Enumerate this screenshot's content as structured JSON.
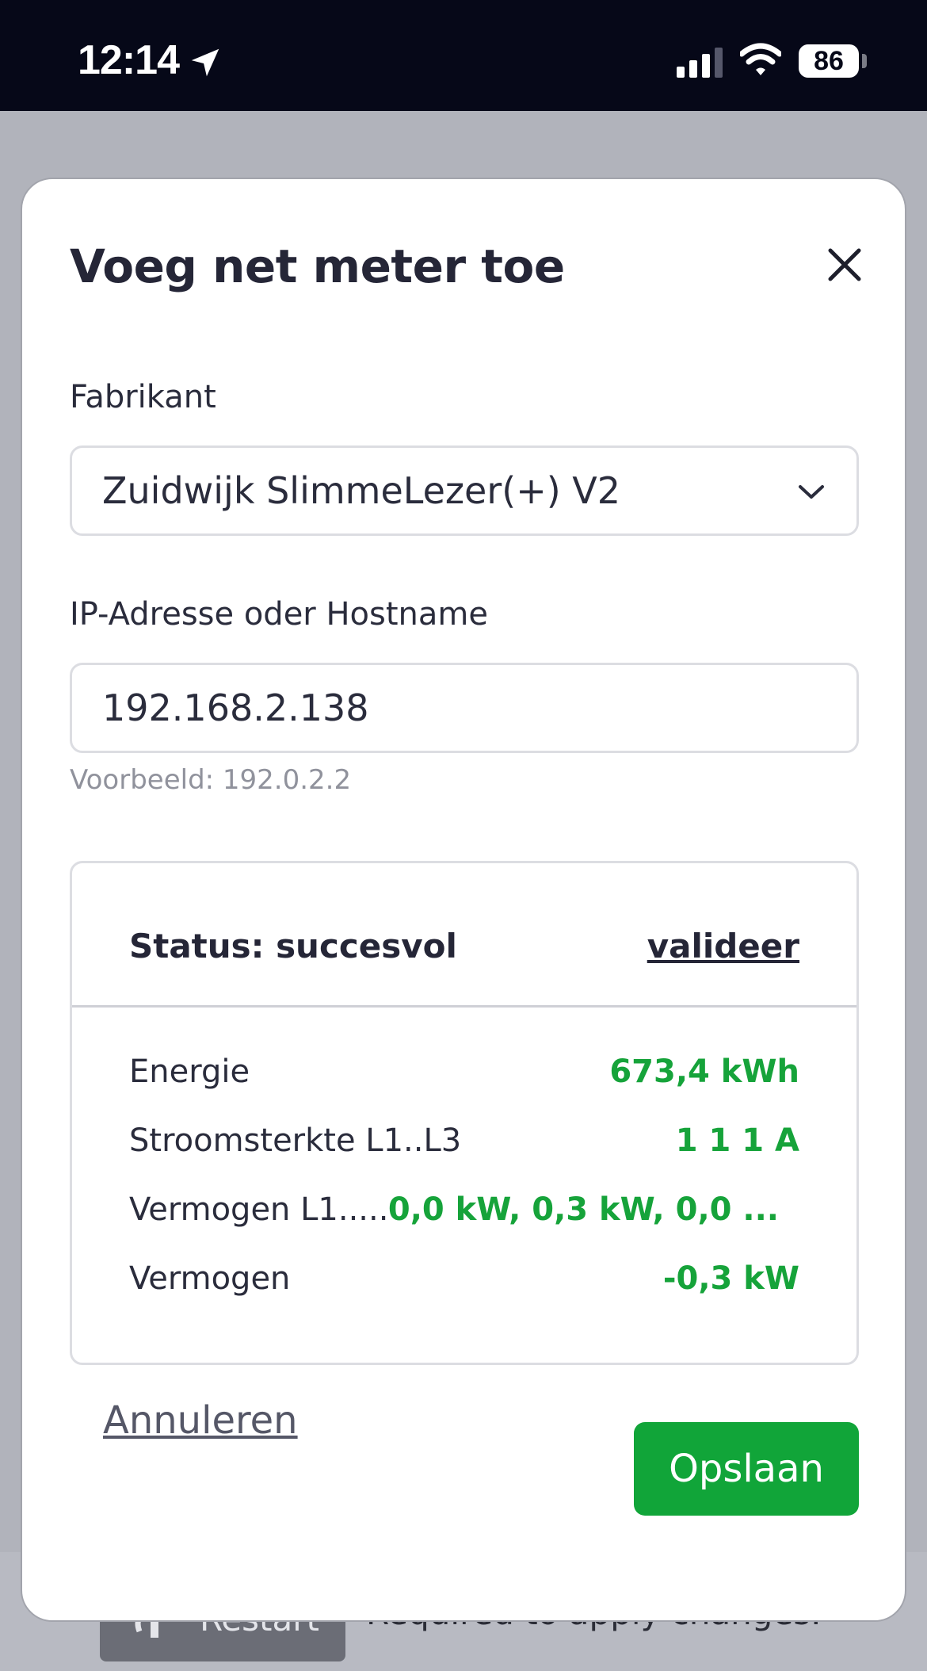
{
  "status_bar": {
    "time": "12:14",
    "battery": "86",
    "location_icon": "location-arrow-icon",
    "signal_icon": "cellular-signal-icon",
    "wifi_icon": "wifi-icon"
  },
  "background": {
    "restart_label": "Restart",
    "restart_note": "Required to apply changes."
  },
  "modal": {
    "title": "Voeg net meter toe",
    "close_icon": "close-icon",
    "manufacturer": {
      "label": "Fabrikant",
      "selected": "Zuidwijk SlimmeLezer(+) V2"
    },
    "address": {
      "label": "IP-Adresse oder Hostname",
      "value": "192.168.2.138",
      "hint": "Voorbeeld: 192.0.2.2"
    },
    "status": {
      "text": "Status: succesvol",
      "validate_label": "valideer",
      "rows": [
        {
          "label": "Energie",
          "value": "673,4 kWh"
        },
        {
          "label": "Stroomsterkte L1..L3",
          "value": "1 1 1 A"
        },
        {
          "label": "Vermogen L1.....",
          "value": "0,0 kW, 0,3 kW, 0,0 ..."
        },
        {
          "label": "Vermogen",
          "value": "-0,3 kW"
        }
      ]
    },
    "cancel_label": "Annuleren",
    "save_label": "Opslaan"
  },
  "colors": {
    "accent_green": "#11a539",
    "value_green": "#16a33a",
    "status_bar_bg": "#060818",
    "overlay_bg": "#b1b3bb"
  }
}
